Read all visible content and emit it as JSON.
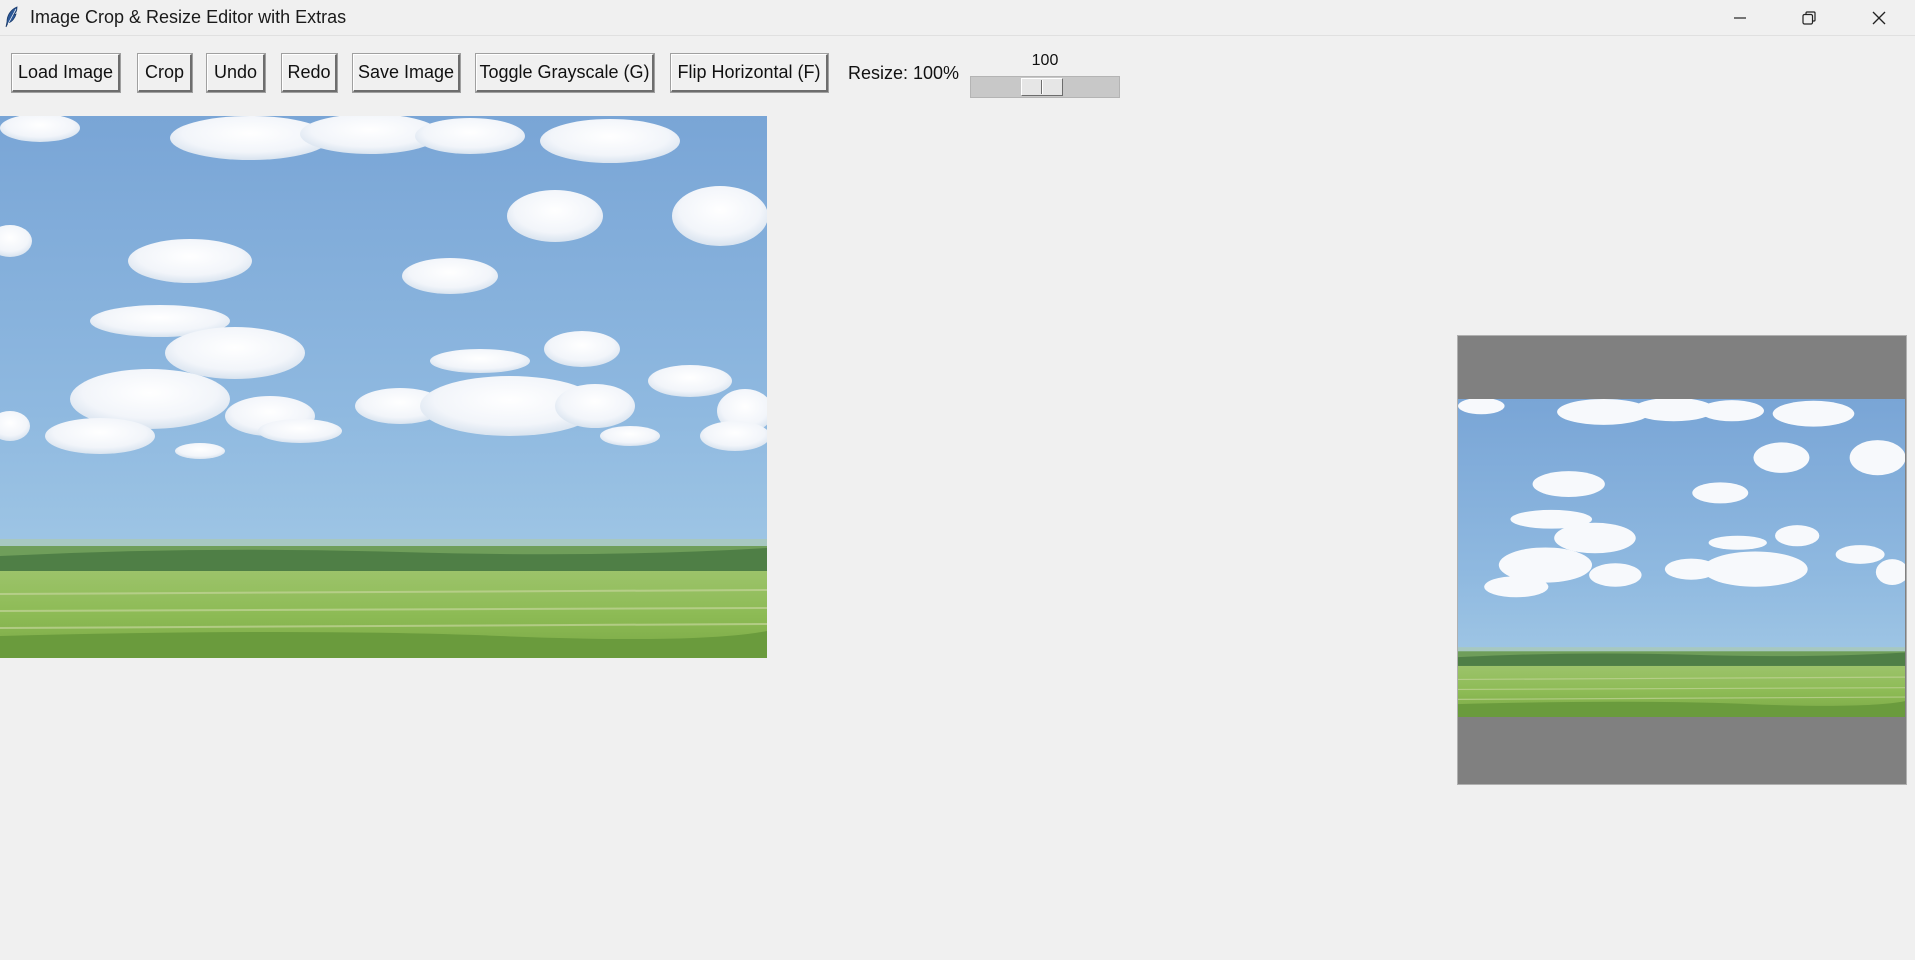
{
  "window": {
    "title": "Image Crop & Resize Editor with Extras",
    "icon": "feather-icon",
    "controls": [
      "minimize-icon",
      "restore-icon",
      "close-icon"
    ]
  },
  "toolbar": {
    "load_label": "Load Image",
    "crop_label": "Crop",
    "undo_label": "Undo",
    "redo_label": "Redo",
    "save_label": "Save Image",
    "grayscale_label": "Toggle Grayscale (G)",
    "flip_label": "Flip Horizontal (F)",
    "resize_label": "Resize: 100%",
    "resize_scale": {
      "value": "100",
      "value_number": 100
    }
  },
  "colors": {
    "window_bg": "#f0f0f0",
    "preview_bg": "#808080",
    "sky_top": "#7fa8d8",
    "sky_bottom": "#a6cbe6",
    "grass": "#8fbf4f",
    "dark_band": "#4e7e46"
  }
}
